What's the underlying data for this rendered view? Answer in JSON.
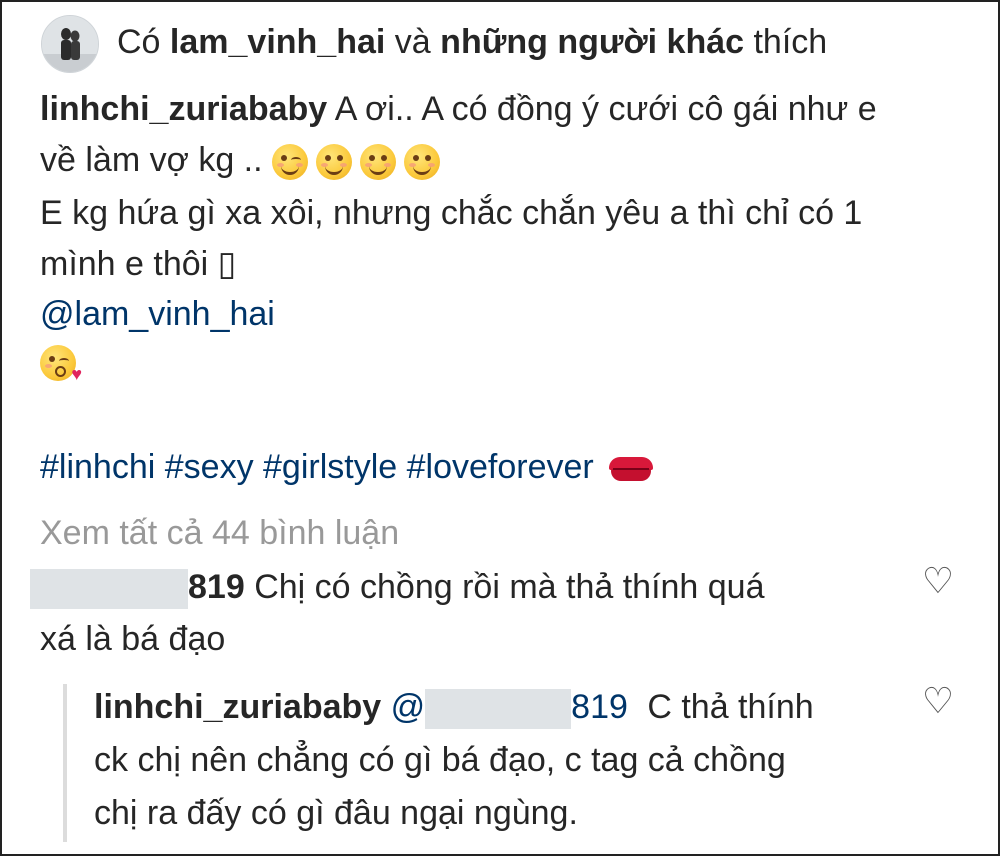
{
  "likes": {
    "prefix": "Có",
    "user": "lam_vinh_hai",
    "conj": "và",
    "others": "những người khác",
    "suffix": "thích"
  },
  "post": {
    "author": "linhchi_zuriababy",
    "line1": "A ơi.. A có đồng ý cưới cô gái như e",
    "line2": "về làm vợ kg ..",
    "line3": "E kg hứa gì xa xôi, nhưng chắc chắn yêu a thì chỉ có 1",
    "line4": "mình e thôi ▯",
    "mention": "@lam_vinh_hai",
    "hashtags": "#linhchi #sexy #girlstyle #loveforever",
    "emojis_line2": [
      "wink-emoji",
      "smile-emoji",
      "smile-emoji",
      "smile-emoji"
    ],
    "emoji_line6": "kiss-emoji"
  },
  "view_all_comments": "Xem tất cả 44 bình luận",
  "comments": [
    {
      "user_suffix": "819",
      "text1": "Chị có chồng rồi mà thả thính quá",
      "text2": "xá là bá đạo",
      "like_icon": "heart-outline-icon"
    }
  ],
  "reply": {
    "author": "linhchi_zuriababy",
    "mention_prefix": "@",
    "mention_suffix": "819",
    "text1": "C thả thính",
    "text2": "ck chị nên chẳng có gì bá đạo, c tag cả chồng",
    "text3": "chị ra đấy có gì đâu ngại ngùng.",
    "like_icon": "heart-outline-icon"
  },
  "colors": {
    "link": "#003569",
    "muted": "#999999",
    "text": "#262626",
    "heart": "#555555"
  }
}
